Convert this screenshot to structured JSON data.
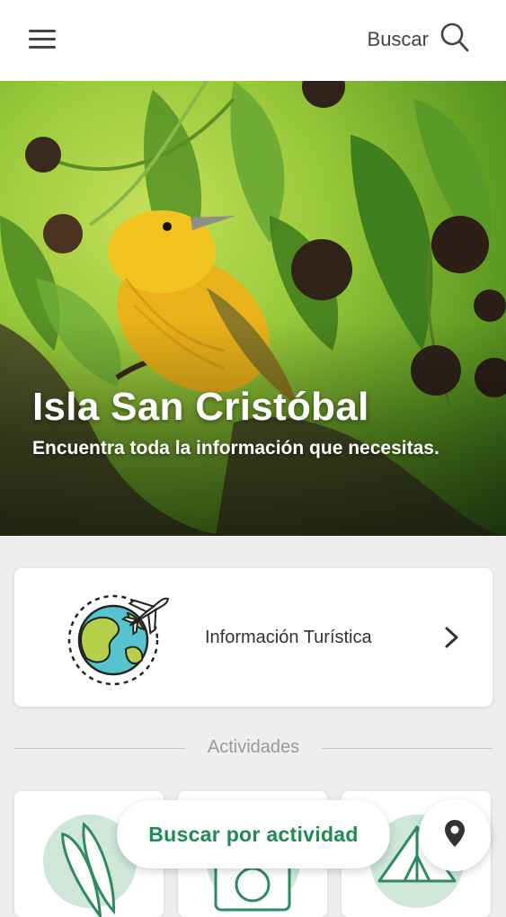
{
  "header": {
    "menu_icon": "hamburger-menu-icon",
    "search_label": "Buscar",
    "search_icon": "search-icon"
  },
  "hero": {
    "title": "Isla San Cristóbal",
    "subtitle": "Encuentra toda la información que necesitas."
  },
  "info_card": {
    "label": "Información Turística",
    "icon": "globe-airplane-icon",
    "chevron_icon": "chevron-right-icon"
  },
  "activities": {
    "section_label": "Actividades",
    "cards": [
      {
        "icon": "surfboard-icon"
      },
      {
        "icon": "camera-icon"
      },
      {
        "icon": "tent-icon"
      }
    ]
  },
  "floating": {
    "search_activity_label": "Buscar por actividad",
    "map_icon": "location-pin-icon"
  },
  "colors": {
    "accent_green": "#1e8a56",
    "header_bg": "#ffffff",
    "page_bg": "#efeded"
  }
}
